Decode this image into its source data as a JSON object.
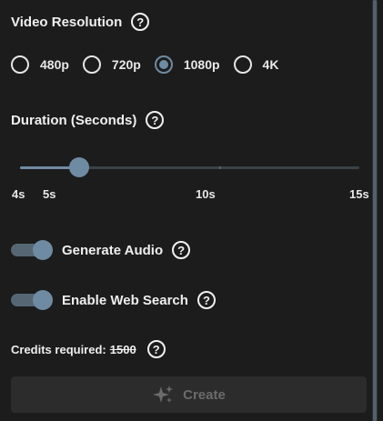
{
  "video_resolution": {
    "label": "Video Resolution",
    "help_icon": "question-circle-icon",
    "help_glyph": "?",
    "options": [
      {
        "label": "480p",
        "selected": false
      },
      {
        "label": "720p",
        "selected": false
      },
      {
        "label": "1080p",
        "selected": true
      },
      {
        "label": "4K",
        "selected": false
      }
    ]
  },
  "duration": {
    "label": "Duration (Seconds)",
    "help_glyph": "?",
    "min": 4,
    "max": 15,
    "value": 5,
    "tick_labels": [
      "4s",
      "5s",
      "10s",
      "15s"
    ],
    "fill_color": "#6f8ba3"
  },
  "toggles": {
    "generate_audio": {
      "label": "Generate Audio",
      "on": true,
      "help_glyph": "?"
    },
    "web_search": {
      "label": "Enable Web Search",
      "on": true,
      "help_glyph": "?"
    }
  },
  "credits": {
    "label": "Credits required:",
    "value": "1500",
    "help_glyph": "?"
  },
  "create_button": {
    "label": "Create",
    "icon": "sparkle-icon",
    "disabled": true
  },
  "colors": {
    "background": "#1c1c1c",
    "accent": "#6f8ba3",
    "button_bg": "#2c2c2c",
    "disabled_text": "#6b6b6b"
  }
}
